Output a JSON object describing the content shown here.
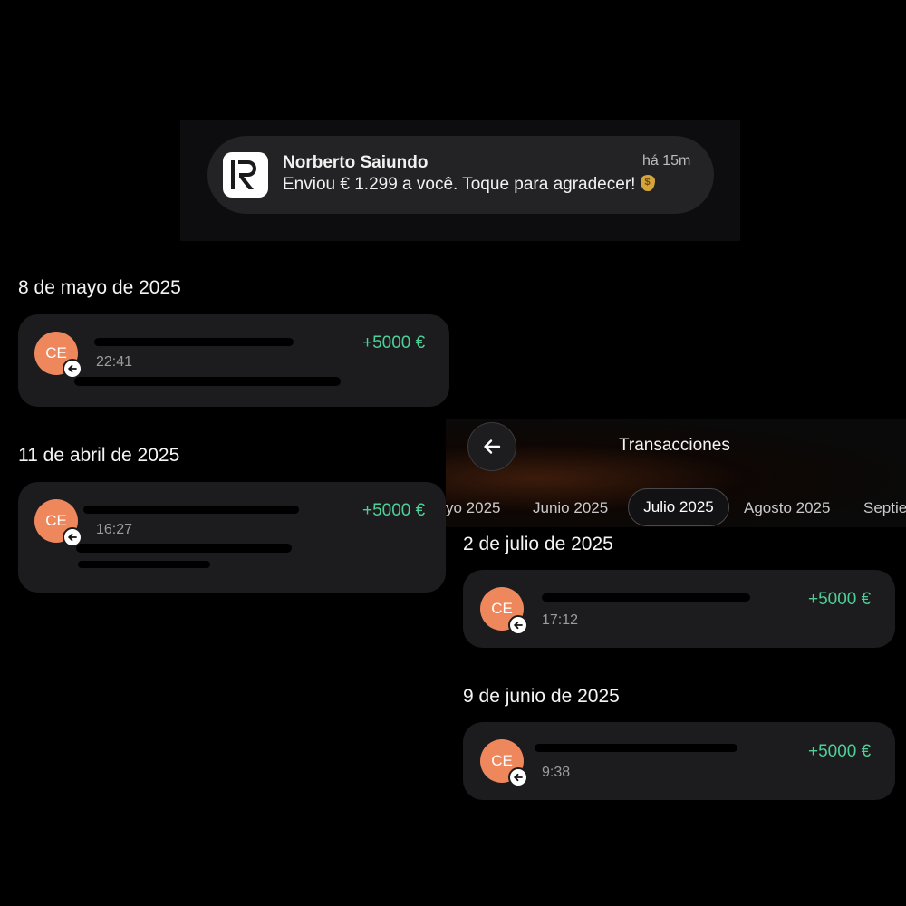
{
  "notification": {
    "sender": "Norberto Saiundo",
    "time": "há 15m",
    "message": "Enviou € 1.299 a você. Toque para agradecer!",
    "app_icon": "R",
    "emoji_icon": "money-bag-icon"
  },
  "left_list": [
    {
      "date": "8 de mayo de 2025",
      "avatar": "CE",
      "time": "22:41",
      "amount": "+5000 €"
    },
    {
      "date": "11 de abril de 2025",
      "avatar": "CE",
      "time": "16:27",
      "amount": "+5000 €"
    }
  ],
  "right_panel": {
    "title": "Transacciones",
    "tabs": [
      "yo 2025",
      "Junio 2025",
      "Julio 2025",
      "Agosto 2025",
      "Septie"
    ],
    "active_tab": "Julio 2025",
    "transactions": [
      {
        "date": "2 de julio de 2025",
        "avatar": "CE",
        "time": "17:12",
        "amount": "+5000 €"
      },
      {
        "date": "9 de junio de 2025",
        "avatar": "CE",
        "time": "9:38",
        "amount": "+5000 €"
      }
    ]
  },
  "colors": {
    "background": "#000000",
    "card": "#1c1c1e",
    "amount_positive": "#4ecf98",
    "avatar": "#ef875c"
  }
}
